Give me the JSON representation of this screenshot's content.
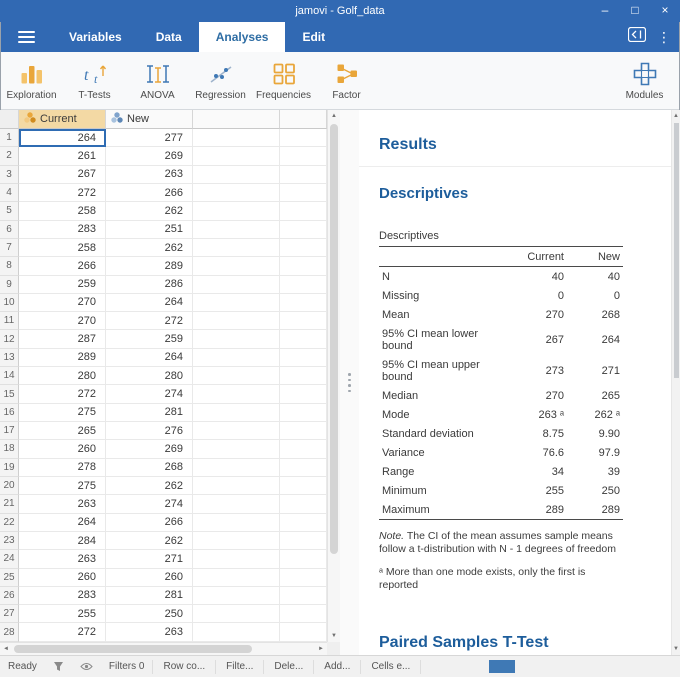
{
  "window": {
    "title": "jamovi - Golf_data"
  },
  "window_controls": {
    "minimize": "–",
    "maximize": "□",
    "close": "×"
  },
  "icons": {
    "kebab": "⋮",
    "scroll_up": "▲",
    "scroll_down": "▼",
    "scroll_left": "◄",
    "scroll_right": "►"
  },
  "colors": {
    "titlebar": "#3169b3",
    "accent": "#3f79b5",
    "orange": "#e9a63a",
    "heading": "#1d5d9b",
    "selected_header": "#f3d9a4"
  },
  "tabs": [
    {
      "label": "Variables",
      "active": false
    },
    {
      "label": "Data",
      "active": false
    },
    {
      "label": "Analyses",
      "active": true
    },
    {
      "label": "Edit",
      "active": false
    }
  ],
  "ribbon": [
    {
      "label": "Exploration",
      "icon": "exploration"
    },
    {
      "label": "T-Tests",
      "icon": "ttests"
    },
    {
      "label": "ANOVA",
      "icon": "anova"
    },
    {
      "label": "Regression",
      "icon": "regression"
    },
    {
      "label": "Frequencies",
      "icon": "frequencies"
    },
    {
      "label": "Factor",
      "icon": "factor"
    }
  ],
  "modules": {
    "label": "Modules"
  },
  "spreadsheet": {
    "columns": [
      {
        "label": "Current",
        "selected": true,
        "icon_colors": [
          "#e9a63a",
          "#f2c981",
          "#d18c1f"
        ]
      },
      {
        "label": "New",
        "selected": false,
        "icon_colors": [
          "#7fa3cc",
          "#a8c2de",
          "#5d87b6"
        ]
      }
    ],
    "rows": [
      [
        264,
        277
      ],
      [
        261,
        269
      ],
      [
        267,
        263
      ],
      [
        272,
        266
      ],
      [
        258,
        262
      ],
      [
        283,
        251
      ],
      [
        258,
        262
      ],
      [
        266,
        289
      ],
      [
        259,
        286
      ],
      [
        270,
        264
      ],
      [
        270,
        272
      ],
      [
        287,
        259
      ],
      [
        289,
        264
      ],
      [
        280,
        280
      ],
      [
        272,
        274
      ],
      [
        275,
        281
      ],
      [
        265,
        276
      ],
      [
        260,
        269
      ],
      [
        278,
        268
      ],
      [
        275,
        262
      ],
      [
        263,
        274
      ],
      [
        264,
        266
      ],
      [
        284,
        262
      ],
      [
        263,
        271
      ],
      [
        260,
        260
      ],
      [
        283,
        281
      ],
      [
        255,
        250
      ],
      [
        272,
        263
      ]
    ]
  },
  "results": {
    "title": "Results",
    "section_title": "Descriptives",
    "table_caption": "Descriptives",
    "table": {
      "headers": [
        "",
        "Current",
        "New"
      ],
      "rows": [
        [
          "N",
          "40",
          "40"
        ],
        [
          "Missing",
          "0",
          "0"
        ],
        [
          "Mean",
          "270",
          "268"
        ],
        [
          "95% CI mean lower bound",
          "267",
          "264"
        ],
        [
          "95% CI mean upper bound",
          "273",
          "271"
        ],
        [
          "Median",
          "270",
          "265"
        ],
        [
          "Mode",
          "263 ᵃ",
          "262 ᵃ"
        ],
        [
          "Standard deviation",
          "8.75",
          "9.90"
        ],
        [
          "Variance",
          "76.6",
          "97.9"
        ],
        [
          "Range",
          "34",
          "39"
        ],
        [
          "Minimum",
          "255",
          "250"
        ],
        [
          "Maximum",
          "289",
          "289"
        ]
      ]
    },
    "note_prefix": "Note.",
    "note_text": "The CI of the mean assumes sample means follow a t-distribution with N - 1 degrees of freedom",
    "mode_note": "ᵃ More than one mode exists, only the first is reported",
    "next_section_title": "Paired Samples T-Test"
  },
  "statusbar": {
    "ready_label": "Ready",
    "filters_label": "Filters 0",
    "buttons": [
      "Row co...",
      "Filte...",
      "Dele...",
      "Add...",
      "Cells e..."
    ]
  }
}
